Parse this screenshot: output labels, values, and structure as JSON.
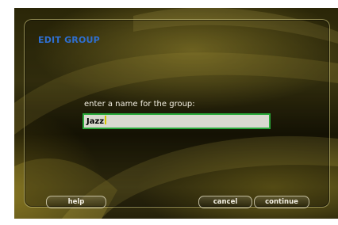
{
  "dialog": {
    "title": "EDIT GROUP",
    "prompt": "enter a name for the group:",
    "name_value": "Jazz"
  },
  "buttons": {
    "help": "help",
    "cancel": "cancel",
    "continue": "continue"
  },
  "colors": {
    "title": "#2f6fd0",
    "field_border": "#2aa93a",
    "field_bg": "#d9d9cf",
    "caret": "#d6c400",
    "text": "#f3efe3"
  }
}
